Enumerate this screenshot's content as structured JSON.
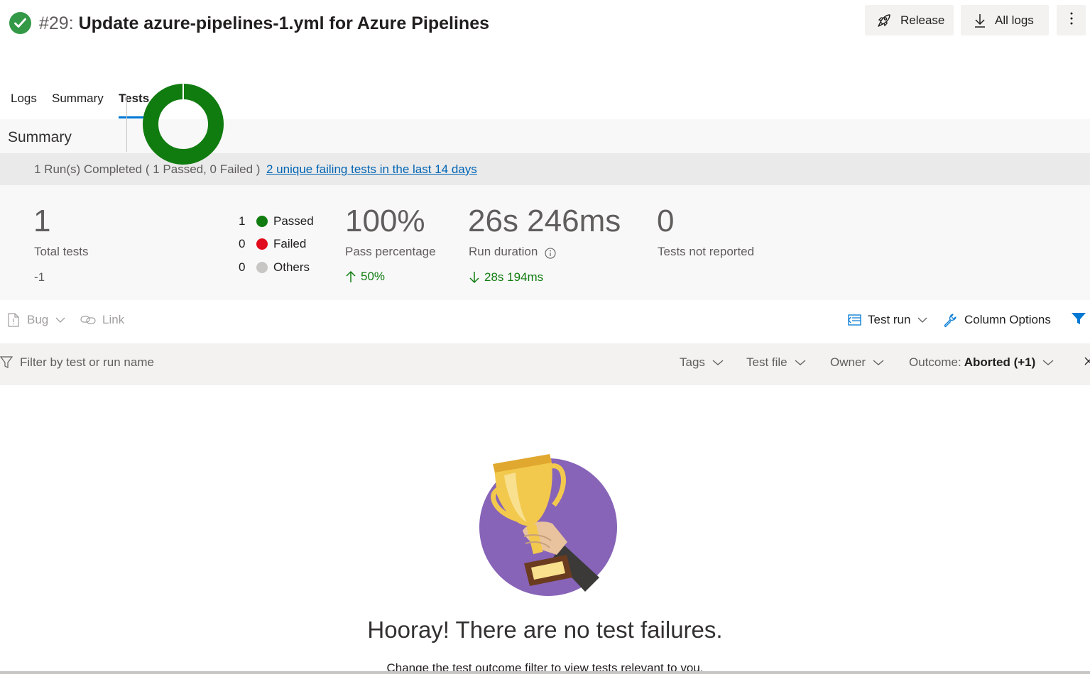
{
  "header": {
    "run_number": "#29:",
    "run_name": "Update azure-pipelines-1.yml for Azure Pipelines",
    "buttons": {
      "release": "Release",
      "all_logs": "All logs"
    },
    "icons": {
      "status": "check-circle-icon",
      "release": "rocket-icon",
      "logs": "download-icon",
      "more": "more-vertical-icon"
    }
  },
  "tabs": [
    {
      "label": "Logs"
    },
    {
      "label": "Summary"
    },
    {
      "label": "Tests"
    }
  ],
  "summary": {
    "heading": "Summary",
    "runs_completed": "1 Run(s) Completed ( 1 Passed, 0 Failed )",
    "failing_link": "2 unique failing tests in the last 14 days",
    "total_tests": {
      "value": "1",
      "label": "Total tests",
      "delta": "-1"
    },
    "outcomes": [
      {
        "count": "1",
        "label": "Passed",
        "color": "#107c10"
      },
      {
        "count": "0",
        "label": "Failed",
        "color": "#e00b1c"
      },
      {
        "count": "0",
        "label": "Others",
        "color": "#c8c6c4"
      }
    ],
    "pass_percentage": {
      "value": "100%",
      "label": "Pass percentage",
      "trend": "50%",
      "fraction": 1.0
    },
    "run_duration": {
      "value": "26s 246ms",
      "label": "Run duration",
      "trend": "28s 194ms"
    },
    "not_reported": {
      "value": "0",
      "label": "Tests not reported"
    }
  },
  "toolbar": {
    "bug": "Bug",
    "link": "Link",
    "test_run": "Test run",
    "column_options": "Column Options"
  },
  "filters": {
    "search_placeholder": "Filter by test or run name",
    "tags": "Tags",
    "test_file": "Test file",
    "owner": "Owner",
    "outcome_label": "Outcome:",
    "outcome_value": "Aborted (+1)"
  },
  "empty_state": {
    "title": "Hooray! There are no test failures.",
    "subtitle": "Change the test outcome filter to view tests relevant to you."
  },
  "colors": {
    "accent": "#0078d4",
    "success": "#107c10",
    "failure": "#e00b1c",
    "trophy_bg": "#8764b8"
  }
}
